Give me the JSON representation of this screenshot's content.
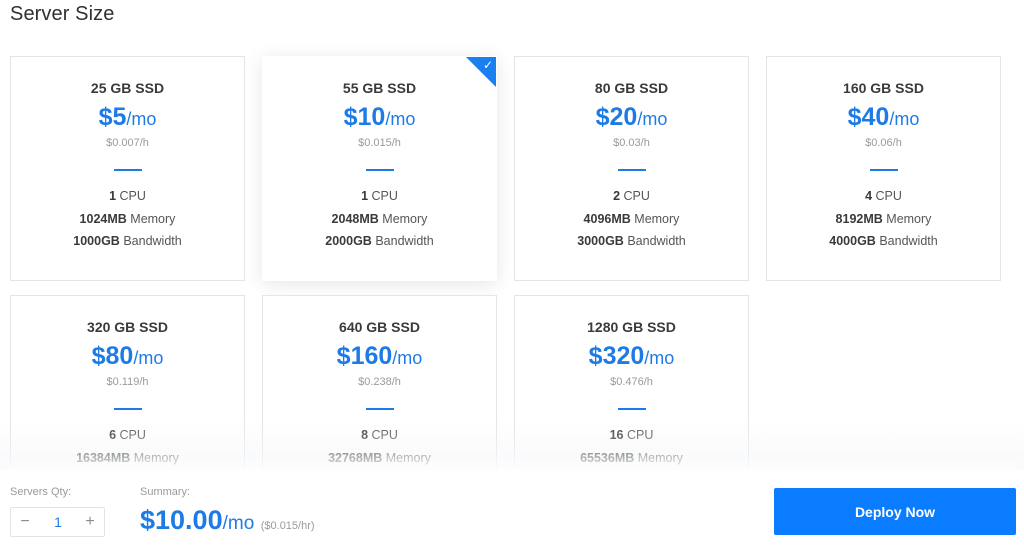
{
  "page": {
    "title": "Server Size"
  },
  "plans": [
    {
      "ssd": "25 GB SSD",
      "price": "$5",
      "unit": "/mo",
      "hourly": "$0.007/h",
      "cpu_value": "1",
      "cpu_label": "CPU",
      "memory_value": "1024MB",
      "memory_label": "Memory",
      "bandwidth_value": "1000GB",
      "bandwidth_label": "Bandwidth",
      "selected": false
    },
    {
      "ssd": "55 GB SSD",
      "price": "$10",
      "unit": "/mo",
      "hourly": "$0.015/h",
      "cpu_value": "1",
      "cpu_label": "CPU",
      "memory_value": "2048MB",
      "memory_label": "Memory",
      "bandwidth_value": "2000GB",
      "bandwidth_label": "Bandwidth",
      "selected": true
    },
    {
      "ssd": "80 GB SSD",
      "price": "$20",
      "unit": "/mo",
      "hourly": "$0.03/h",
      "cpu_value": "2",
      "cpu_label": "CPU",
      "memory_value": "4096MB",
      "memory_label": "Memory",
      "bandwidth_value": "3000GB",
      "bandwidth_label": "Bandwidth",
      "selected": false
    },
    {
      "ssd": "160 GB SSD",
      "price": "$40",
      "unit": "/mo",
      "hourly": "$0.06/h",
      "cpu_value": "4",
      "cpu_label": "CPU",
      "memory_value": "8192MB",
      "memory_label": "Memory",
      "bandwidth_value": "4000GB",
      "bandwidth_label": "Bandwidth",
      "selected": false
    },
    {
      "ssd": "320 GB SSD",
      "price": "$80",
      "unit": "/mo",
      "hourly": "$0.119/h",
      "cpu_value": "6",
      "cpu_label": "CPU",
      "memory_value": "16384MB",
      "memory_label": "Memory",
      "bandwidth_value": "",
      "bandwidth_label": "",
      "selected": false
    },
    {
      "ssd": "640 GB SSD",
      "price": "$160",
      "unit": "/mo",
      "hourly": "$0.238/h",
      "cpu_value": "8",
      "cpu_label": "CPU",
      "memory_value": "32768MB",
      "memory_label": "Memory",
      "bandwidth_value": "",
      "bandwidth_label": "",
      "selected": false
    },
    {
      "ssd": "1280 GB SSD",
      "price": "$320",
      "unit": "/mo",
      "hourly": "$0.476/h",
      "cpu_value": "16",
      "cpu_label": "CPU",
      "memory_value": "65536MB",
      "memory_label": "Memory",
      "bandwidth_value": "",
      "bandwidth_label": "",
      "selected": false
    }
  ],
  "selected_icon": "checkmark-icon",
  "selected_check_glyph": "✓",
  "footer": {
    "qty_label": "Servers Qty:",
    "qty_value": "1",
    "minus_glyph": "−",
    "plus_glyph": "+",
    "summary_label": "Summary:",
    "summary_price": "$10.00",
    "summary_unit": "/mo",
    "summary_hourly": "($0.015/hr)",
    "deploy_label": "Deploy Now"
  },
  "colors": {
    "accent": "#1e7be6",
    "button": "#0a7cff"
  }
}
